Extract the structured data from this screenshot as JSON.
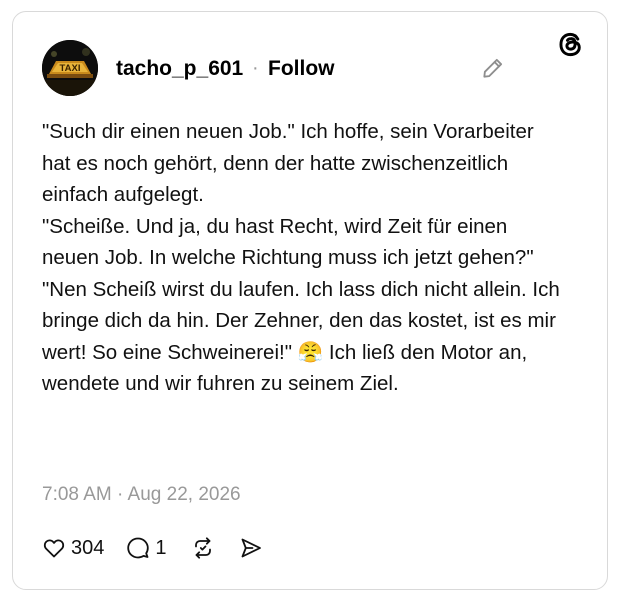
{
  "post": {
    "author": "tacho_p_601",
    "separator": "·",
    "follow_label": "Follow",
    "avatar_sign_text": "TAXI",
    "text": "\"Such dir einen neuen Job.\" Ich hoffe, sein Vorarbeiter hat es noch gehört, denn der hatte zwischenzeitlich einfach aufgelegt.\n\"Scheiße. Und ja, du hast Recht, wird Zeit für einen neuen Job. In welche Richtung muss ich jetzt gehen?\"\n\"Nen Scheiß wirst du laufen. Ich lass dich nicht allein. Ich bringe dich da hin. Der Zehner, den das kostet, ist es mir wert! So eine Schweinerei!\" 😤 Ich ließ den Motor an, wendete und wir fuhren zu seinem Ziel.",
    "timestamp": "7:08 AM · Aug 22, 2026",
    "likes": "304",
    "replies": "1"
  },
  "icons": {
    "edit": "pencil-icon",
    "logo": "threads-logo-icon",
    "like": "heart-icon",
    "reply": "comment-icon",
    "repost": "repost-icon",
    "share": "send-icon"
  },
  "colors": {
    "text": "#111111",
    "muted": "#999999",
    "border": "#d9d9d9"
  }
}
